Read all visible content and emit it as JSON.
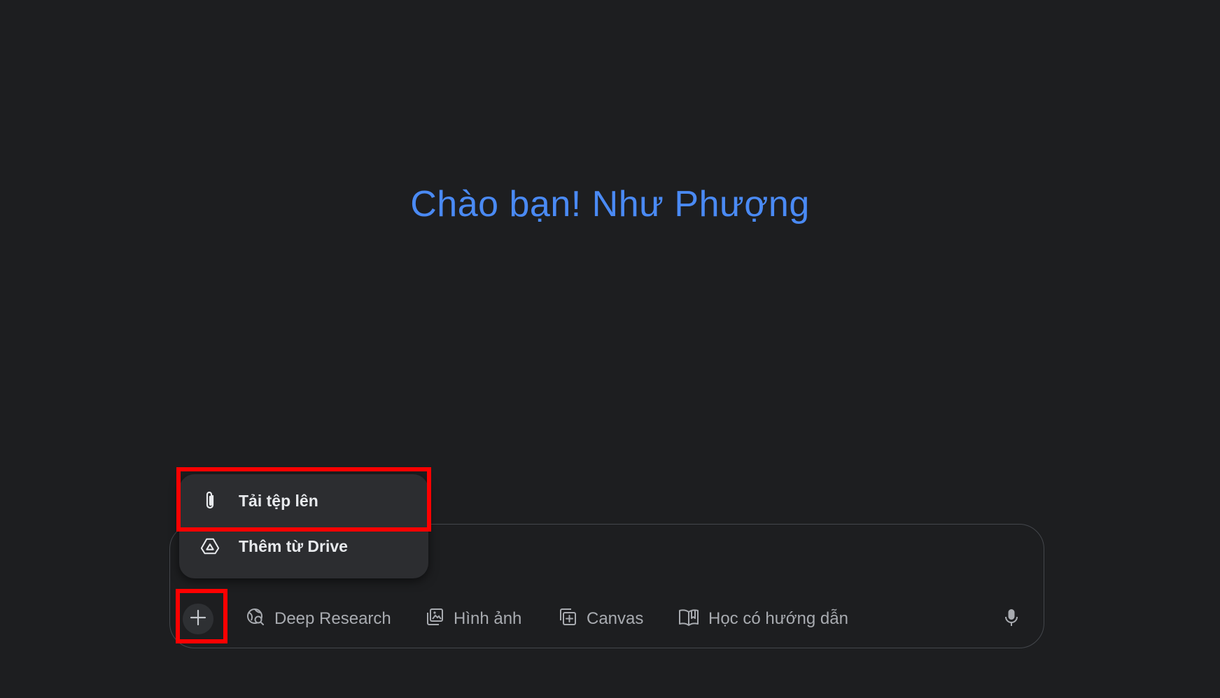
{
  "greeting": "Chào bạn! Như Phượng",
  "composer": {
    "add_icon": "plus-icon",
    "tools": [
      {
        "label": "Deep Research",
        "icon": "globe-search-icon"
      },
      {
        "label": "Hình ảnh",
        "icon": "image-gallery-icon"
      },
      {
        "label": "Canvas",
        "icon": "canvas-add-icon"
      },
      {
        "label": "Học có hướng dẫn",
        "icon": "open-book-icon"
      }
    ],
    "mic_icon": "microphone-icon"
  },
  "attach_menu": {
    "items": [
      {
        "label": "Tải tệp lên",
        "icon": "paperclip-icon"
      },
      {
        "label": "Thêm từ Drive",
        "icon": "drive-icon"
      }
    ]
  },
  "colors": {
    "background": "#1d1e20",
    "greeting": "#4a8af4",
    "highlight": "#ff0000",
    "menu_bg": "#2c2d30"
  }
}
